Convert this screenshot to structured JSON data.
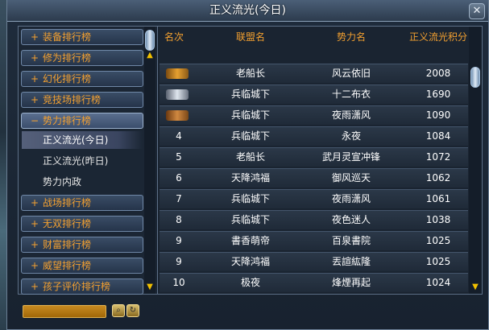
{
  "window": {
    "title": "正义流光(今日)",
    "close_label": "✕"
  },
  "nav": {
    "items": [
      {
        "label": "装备排行榜",
        "state": "+"
      },
      {
        "label": "修为排行榜",
        "state": "+"
      },
      {
        "label": "幻化排行榜",
        "state": "+"
      },
      {
        "label": "竞技场排行榜",
        "state": "+"
      },
      {
        "label": "势力排行榜",
        "state": "−"
      },
      {
        "label": "战场排行榜",
        "state": "+"
      },
      {
        "label": "无双排行榜",
        "state": "+"
      },
      {
        "label": "财富排行榜",
        "state": "+"
      },
      {
        "label": "威望排行榜",
        "state": "+"
      },
      {
        "label": "孩子评价排行榜",
        "state": "+"
      }
    ],
    "subitems": [
      {
        "label": "正义流光(今日)",
        "active": true
      },
      {
        "label": "正义流光(昨日)",
        "active": false
      },
      {
        "label": "势力内政",
        "active": false
      }
    ]
  },
  "table": {
    "headers": {
      "rank": "名次",
      "alliance": "联盟名",
      "faction": "势力名",
      "score": "正义流光积分"
    },
    "rows": [
      {
        "rank": "",
        "badge": "gold",
        "alliance": "老船长",
        "faction": "风云依旧",
        "score": "2008"
      },
      {
        "rank": "",
        "badge": "silver",
        "alliance": "兵临城下",
        "faction": "十二布衣",
        "score": "1690"
      },
      {
        "rank": "",
        "badge": "bronze",
        "alliance": "兵临城下",
        "faction": "夜雨潇风",
        "score": "1090"
      },
      {
        "rank": "4",
        "badge": "",
        "alliance": "兵临城下",
        "faction": "永夜",
        "score": "1084"
      },
      {
        "rank": "5",
        "badge": "",
        "alliance": "老船长",
        "faction": "武月灵宣冲锋",
        "score": "1072"
      },
      {
        "rank": "6",
        "badge": "",
        "alliance": "天降鸿福",
        "faction": "御风巡天",
        "score": "1062"
      },
      {
        "rank": "7",
        "badge": "",
        "alliance": "兵临城下",
        "faction": "夜雨潇风",
        "score": "1061"
      },
      {
        "rank": "8",
        "badge": "",
        "alliance": "兵临城下",
        "faction": "夜色迷人",
        "score": "1038"
      },
      {
        "rank": "9",
        "badge": "",
        "alliance": "書香萌帝",
        "faction": "百泉書院",
        "score": "1025"
      },
      {
        "rank": "9",
        "badge": "",
        "alliance": "天降鸿福",
        "faction": "丟諠紘隆",
        "score": "1025"
      },
      {
        "rank": "10",
        "badge": "",
        "alliance": "极夜",
        "faction": "烽煙再起",
        "score": "1024"
      }
    ]
  },
  "bottom": {
    "search_value": "",
    "search_icon": "magnifier-icon",
    "refresh_icon": "refresh-icon"
  }
}
